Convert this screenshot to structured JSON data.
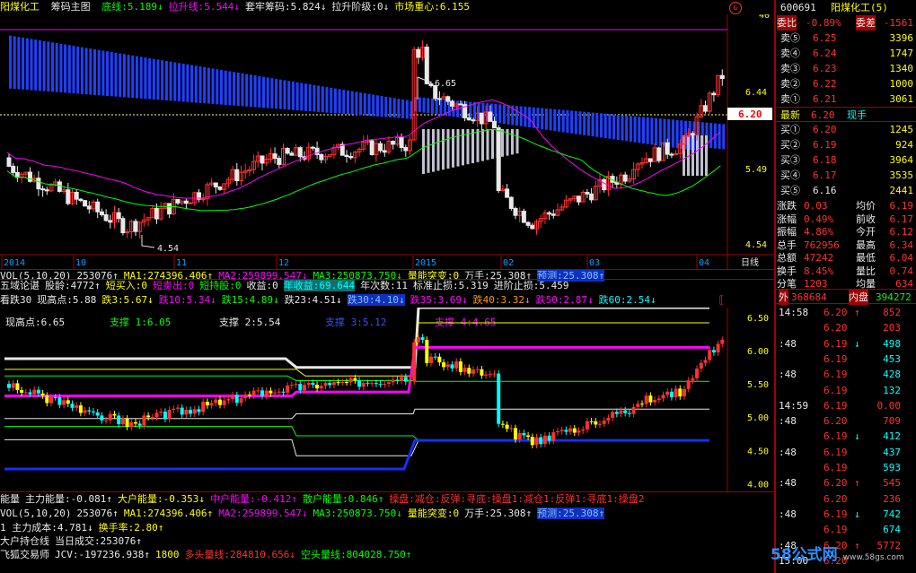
{
  "title_bar": {
    "name": "阳煤化工",
    "formula": "筹码主图",
    "items": [
      {
        "label": "底线:5.189",
        "color": "#00ff00",
        "arrow": "↓"
      },
      {
        "label": "拉升线:5.544",
        "color": "#ff00ff",
        "arrow": "↓"
      },
      {
        "label": "套牢筹码:5.824",
        "color": "#e8e8e8",
        "arrow": "↓"
      },
      {
        "label": "拉升阶级:0",
        "color": "#e8e8e8",
        "arrow": "↓"
      },
      {
        "label": "市场重心:6.155",
        "color": "#ffff00",
        "arrow": ""
      }
    ]
  },
  "main_chart": {
    "ymax": 6.9,
    "ymin": 4.4,
    "price_labels": [
      "6.44",
      "5.49",
      "4.54"
    ],
    "top_label": "40",
    "current_tag": "6.20",
    "high_ann": "6.65",
    "low_ann": "4.54",
    "dates": [
      "2014",
      "10",
      "11",
      "12",
      "2015",
      "02",
      "03",
      "04"
    ],
    "period": "日线"
  },
  "vol_row": {
    "items": [
      {
        "t": "VOL(5,10,20)",
        "c": "w"
      },
      {
        "t": "253076↑",
        "c": "w"
      },
      {
        "t": "MA1:274396.406↑",
        "c": "y"
      },
      {
        "t": "MA2:259899.547↓",
        "c": "m"
      },
      {
        "t": "MA3:250873.750↓",
        "c": "g"
      },
      {
        "t": "量能突变:0",
        "c": "y"
      },
      {
        "t": "万手:25.308↑",
        "c": "w"
      },
      {
        "t": "预测:25.308↑",
        "c": "hl-b"
      }
    ]
  },
  "wuxing_row": {
    "items": [
      {
        "t": "五域论谌",
        "c": "w"
      },
      {
        "t": "股龄:4772↑",
        "c": "w"
      },
      {
        "t": "短买入:0",
        "c": "y"
      },
      {
        "t": "短卖出:0",
        "c": "m"
      },
      {
        "t": "短持股:0",
        "c": "g"
      },
      {
        "t": "收益:0",
        "c": "w"
      },
      {
        "t": "年收益:69.644",
        "c": "hl-c"
      },
      {
        "t": "年次数:11",
        "c": "w"
      },
      {
        "t": "标准止损:5.319",
        "c": "w"
      },
      {
        "t": "进阶止损:5.459",
        "c": "w"
      }
    ]
  },
  "kan_row": {
    "items": [
      {
        "t": "看跌30",
        "c": "w"
      },
      {
        "t": "现高点:5.88",
        "c": "w"
      },
      {
        "t": "跌3:5.67↓",
        "c": "y"
      },
      {
        "t": "跌10:5.34↓",
        "c": "m"
      },
      {
        "t": "跌15:4.89↓",
        "c": "g"
      },
      {
        "t": "跌23:4.51↓",
        "c": "w"
      },
      {
        "t": "跌30:4.10↓",
        "c": "hl-b"
      },
      {
        "t": "跌35:3.69↓",
        "c": "m"
      },
      {
        "t": "跌40:3.32↓",
        "c": "o"
      },
      {
        "t": "跌50:2.87↓",
        "c": "m"
      },
      {
        "t": "跌60:2.54↓",
        "c": "c"
      }
    ]
  },
  "sub_chart": {
    "labels": [
      {
        "t": "现高点:6.65",
        "c": "#e8e8e8"
      },
      {
        "t": "支撑 1:6.05",
        "c": "#00ff00"
      },
      {
        "t": "支撑 2:5.54",
        "c": "#e8e8e8"
      },
      {
        "t": "支撑 3:5.12",
        "c": "#3050ff"
      },
      {
        "t": "支撑 4:4.65",
        "c": "#ff00ff"
      }
    ],
    "price_labels": [
      "6.50",
      "6.00",
      "5.50",
      "5.00",
      "4.50",
      "4.00"
    ]
  },
  "energy_row": {
    "items": [
      {
        "t": "能量",
        "c": "w"
      },
      {
        "t": "主力能量:-0.081↑",
        "c": "w"
      },
      {
        "t": "大户能量:-0.353↓",
        "c": "y"
      },
      {
        "t": "中户能量:-0.412↑",
        "c": "m"
      },
      {
        "t": "散户能量:0.846↑",
        "c": "g"
      },
      {
        "t": "操盘:减仓:反弹:寻底:操盘1:减仓1:反弹1:寻底1:操盘2",
        "c": "r"
      }
    ]
  },
  "vol2_row": {
    "items": [
      {
        "t": "VOL(5,10,20)",
        "c": "w"
      },
      {
        "t": "253076↑",
        "c": "w"
      },
      {
        "t": "MA1:274396.406↑",
        "c": "y"
      },
      {
        "t": "MA2:259899.547↓",
        "c": "m"
      },
      {
        "t": "MA3:250873.750↓",
        "c": "g"
      },
      {
        "t": "量能突变:0",
        "c": "y"
      },
      {
        "t": "万手:25.308↑",
        "c": "w"
      },
      {
        "t": "预测:25.308↑",
        "c": "hl-b"
      }
    ]
  },
  "cost_row": {
    "items": [
      {
        "t": "1 主力成本:4.781↓",
        "c": "w"
      },
      {
        "t": "换手率:2.80↑",
        "c": "y"
      }
    ]
  },
  "hold_row": {
    "items": [
      {
        "t": "大户持仓线",
        "c": "w"
      },
      {
        "t": "当日成交:253076↑",
        "c": "w"
      }
    ]
  },
  "fox_row": {
    "items": [
      {
        "t": "飞狐交易师",
        "c": "w"
      },
      {
        "t": "JCV:-197236.938↑",
        "c": "w"
      },
      {
        "t": "1800",
        "c": "y"
      },
      {
        "t": "多头量线:284810.656↓",
        "c": "r"
      },
      {
        "t": "空头量线:804028.750↑",
        "c": "g"
      }
    ]
  },
  "quote": {
    "code": "600691",
    "name": "阳煤化工(5)",
    "wei": "委比",
    "wei_val": "-0.89%",
    "wei_cha": "委差",
    "wei_cha_val": "-1561",
    "sells": [
      {
        "l": "卖⑤",
        "p": "6.25",
        "v": "3396"
      },
      {
        "l": "卖④",
        "p": "6.24",
        "v": "1747"
      },
      {
        "l": "卖③",
        "p": "6.23",
        "v": "1340"
      },
      {
        "l": "卖②",
        "p": "6.22",
        "v": "1000"
      },
      {
        "l": "卖①",
        "p": "6.21",
        "v": "3061"
      }
    ],
    "latest": "最新",
    "latest_val": "6.20",
    "latest_tag": "现手",
    "buys": [
      {
        "l": "买①",
        "p": "6.20",
        "v": "1245"
      },
      {
        "l": "买②",
        "p": "6.19",
        "v": "924"
      },
      {
        "l": "买③",
        "p": "6.18",
        "v": "3964"
      },
      {
        "l": "买④",
        "p": "6.17",
        "v": "3535"
      },
      {
        "l": "买⑤",
        "p": "6.16",
        "v": "2441"
      }
    ],
    "stats": [
      {
        "a": "涨跌",
        "av": "0.03",
        "b": "均价",
        "bv": "6.19"
      },
      {
        "a": "涨幅",
        "av": "0.49%",
        "b": "前收",
        "bv": "6.17"
      },
      {
        "a": "振幅",
        "av": "4.86%",
        "b": "今开",
        "bv": "6.12"
      },
      {
        "a": "总手",
        "av": "762956",
        "b": "最高",
        "bv": "6.34"
      },
      {
        "a": "总额",
        "av": "47242",
        "b": "最低",
        "bv": "6.04"
      },
      {
        "a": "换手",
        "av": "8.45%",
        "b": "量比",
        "bv": "0.74"
      },
      {
        "a": "分笔",
        "av": "1203",
        "b": "均量",
        "bv": "634"
      }
    ],
    "outer": "外",
    "outer_val": "368684",
    "inner": "内盘",
    "inner_val": "394272",
    "ticks": [
      {
        "t": "14:58",
        "p": "6.20",
        "a": "↑",
        "v": "852",
        "c": "r"
      },
      {
        "t": "",
        "p": "6.20",
        "a": "",
        "v": "203",
        "c": "r"
      },
      {
        "t": ":48",
        "p": "6.19",
        "a": "↓",
        "v": "498",
        "c": "c"
      },
      {
        "t": "",
        "p": "6.19",
        "a": "",
        "v": "453",
        "c": "c"
      },
      {
        "t": ":48",
        "p": "6.19",
        "a": "",
        "v": "428",
        "c": "c"
      },
      {
        "t": "",
        "p": "6.19",
        "a": "",
        "v": "132",
        "c": "c"
      },
      {
        "t": "14:59",
        "p": "6.19",
        "a": "",
        "v": "0.00",
        "c": "r"
      },
      {
        "t": ":48",
        "p": "6.20",
        "a": "",
        "v": "709",
        "c": "r"
      },
      {
        "t": "",
        "p": "6.19",
        "a": "↓",
        "v": "412",
        "c": "c"
      },
      {
        "t": ":48",
        "p": "6.19",
        "a": "",
        "v": "437",
        "c": "c"
      },
      {
        "t": "",
        "p": "6.19",
        "a": "",
        "v": "593",
        "c": "c"
      },
      {
        "t": ":48",
        "p": "6.20",
        "a": "↑",
        "v": "545",
        "c": "r"
      },
      {
        "t": "",
        "p": "6.20",
        "a": "",
        "v": "236",
        "c": "r"
      },
      {
        "t": ":48",
        "p": "6.19",
        "a": "↓",
        "v": "742",
        "c": "c"
      },
      {
        "t": "",
        "p": "6.19",
        "a": "",
        "v": "674",
        "c": "c"
      },
      {
        "t": ":48",
        "p": "6.20",
        "a": "↑",
        "v": "5772",
        "c": "r"
      },
      {
        "t": "15:00",
        "p": "6.20",
        "a": "",
        "v": "",
        "c": "r"
      }
    ]
  },
  "watermark": "58公式网",
  "watermark_url": "www.58gs.com",
  "colors": {
    "up": "#ff3030",
    "down": "#00ffff",
    "accent": "#ff00ff"
  }
}
